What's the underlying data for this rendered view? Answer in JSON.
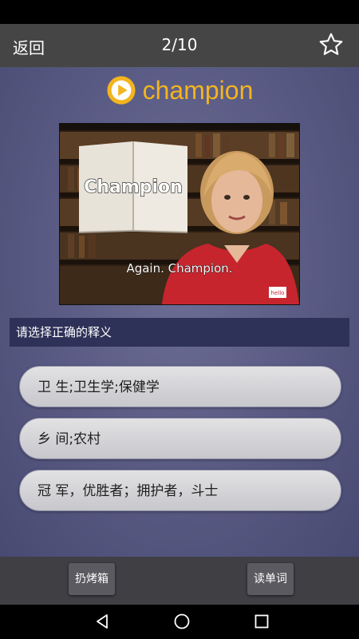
{
  "header": {
    "back_label": "返回",
    "progress": "2/10",
    "favorite_icon": "star-outline-icon"
  },
  "word": {
    "text": "champion",
    "play_icon": "play-circle-icon",
    "accent_color": "#f3b51f"
  },
  "video": {
    "book_title": "Champion",
    "subtitle": "Again. Champion.",
    "shirt_logo": "hello"
  },
  "quiz": {
    "prompt": "请选择正确的释义",
    "options": [
      "卫 生;卫生学;保健学",
      "乡 间;农村",
      "冠 军，优胜者；拥护者，斗士"
    ]
  },
  "toolbar": {
    "trash_label": "扔烤箱",
    "read_words_label": "读单词"
  },
  "system_nav": {
    "back_icon": "triangle-back-icon",
    "home_icon": "circle-home-icon",
    "recents_icon": "square-recents-icon"
  }
}
